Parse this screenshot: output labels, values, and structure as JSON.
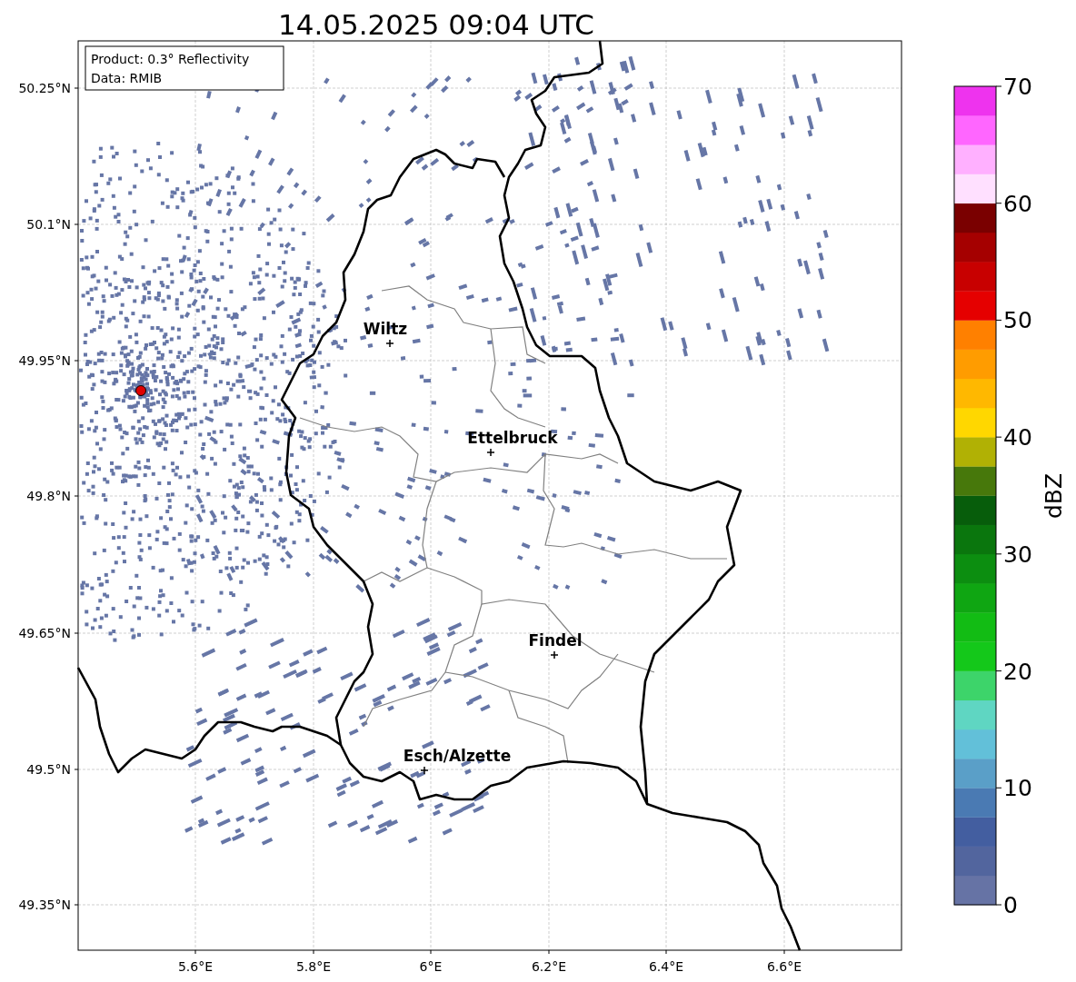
{
  "title": "14.05.2025 09:04 UTC",
  "info_box": [
    "Product: 0.3° Reflectivity",
    "Data: RMIB"
  ],
  "y_ticks": [
    "50.25°N",
    "50.1°N",
    "49.95°N",
    "49.8°N",
    "49.65°N",
    "49.5°N",
    "49.35°N"
  ],
  "x_ticks": [
    "5.6°E",
    "5.8°E",
    "6°E",
    "6.2°E",
    "6.4°E",
    "6.6°E"
  ],
  "cities": [
    {
      "name": "Wiltz"
    },
    {
      "name": "Ettelbruck"
    },
    {
      "name": "Findel"
    },
    {
      "name": "Esch/Alzette"
    }
  ],
  "colorbar": {
    "label": "dBZ",
    "ticks": [
      "70",
      "60",
      "50",
      "40",
      "30",
      "20",
      "10",
      "0"
    ],
    "bins": [
      {
        "color": "#6673a5"
      },
      {
        "color": "#52659e"
      },
      {
        "color": "#435ea0"
      },
      {
        "color": "#4a7ab3"
      },
      {
        "color": "#5a9fc8"
      },
      {
        "color": "#62c0d9"
      },
      {
        "color": "#5fd6c2"
      },
      {
        "color": "#3dd46a"
      },
      {
        "color": "#14c81a"
      },
      {
        "color": "#12bc14"
      },
      {
        "color": "#0fa612"
      },
      {
        "color": "#0c8e10"
      },
      {
        "color": "#0a760d"
      },
      {
        "color": "#075d0b"
      },
      {
        "color": "#47780b"
      },
      {
        "color": "#b1b104"
      },
      {
        "color": "#ffd700"
      },
      {
        "color": "#ffb800"
      },
      {
        "color": "#ff9c00"
      },
      {
        "color": "#ff8000"
      },
      {
        "color": "#e50000"
      },
      {
        "color": "#c80000"
      },
      {
        "color": "#a50000"
      },
      {
        "color": "#7a0000"
      },
      {
        "color": "#ffe0ff"
      },
      {
        "color": "#ffb0ff"
      },
      {
        "color": "#ff66ff"
      },
      {
        "color": "#ee33ee"
      }
    ]
  }
}
